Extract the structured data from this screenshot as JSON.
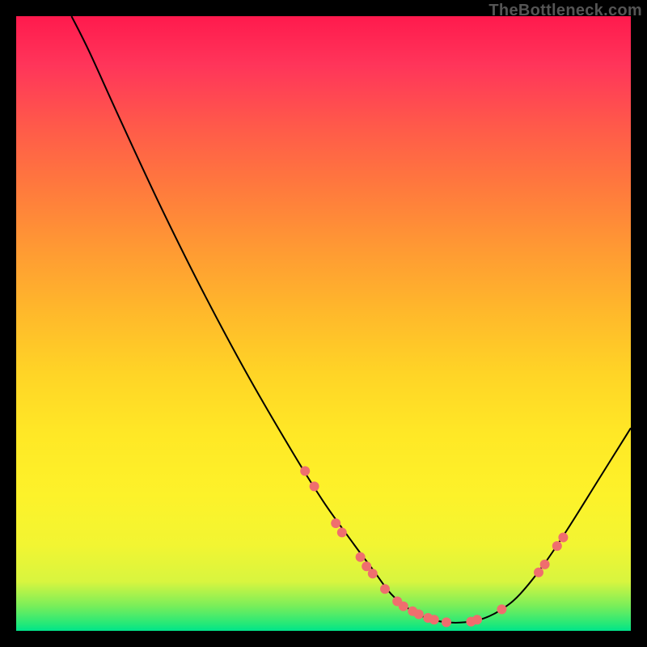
{
  "watermark": "TheBottleneck.com",
  "chart_data": {
    "type": "line",
    "title": "",
    "xlabel": "",
    "ylabel": "",
    "xlim": [
      0,
      100
    ],
    "ylim": [
      0,
      100
    ],
    "curve": [
      {
        "x": 9,
        "y": 100
      },
      {
        "x": 12,
        "y": 94
      },
      {
        "x": 17,
        "y": 83
      },
      {
        "x": 24,
        "y": 68
      },
      {
        "x": 31,
        "y": 54
      },
      {
        "x": 38,
        "y": 41
      },
      {
        "x": 45,
        "y": 29
      },
      {
        "x": 50,
        "y": 21
      },
      {
        "x": 55,
        "y": 14
      },
      {
        "x": 58,
        "y": 10
      },
      {
        "x": 61,
        "y": 6
      },
      {
        "x": 64,
        "y": 3.5
      },
      {
        "x": 67,
        "y": 2.0
      },
      {
        "x": 70,
        "y": 1.4
      },
      {
        "x": 73,
        "y": 1.4
      },
      {
        "x": 76,
        "y": 2.0
      },
      {
        "x": 79,
        "y": 3.5
      },
      {
        "x": 82,
        "y": 6
      },
      {
        "x": 86,
        "y": 11
      },
      {
        "x": 90,
        "y": 17
      },
      {
        "x": 95,
        "y": 25
      },
      {
        "x": 100,
        "y": 33
      }
    ],
    "markers": [
      {
        "x": 47,
        "y": 26
      },
      {
        "x": 48.5,
        "y": 23.5
      },
      {
        "x": 52,
        "y": 17.5
      },
      {
        "x": 53,
        "y": 16
      },
      {
        "x": 56,
        "y": 12
      },
      {
        "x": 57,
        "y": 10.5
      },
      {
        "x": 58,
        "y": 9.3
      },
      {
        "x": 60,
        "y": 6.8
      },
      {
        "x": 62,
        "y": 4.8
      },
      {
        "x": 63,
        "y": 4.0
      },
      {
        "x": 64.5,
        "y": 3.2
      },
      {
        "x": 65.5,
        "y": 2.7
      },
      {
        "x": 67,
        "y": 2.1
      },
      {
        "x": 68,
        "y": 1.8
      },
      {
        "x": 70,
        "y": 1.4
      },
      {
        "x": 74,
        "y": 1.5
      },
      {
        "x": 75,
        "y": 1.8
      },
      {
        "x": 79,
        "y": 3.5
      },
      {
        "x": 85,
        "y": 9.5
      },
      {
        "x": 86,
        "y": 10.8
      },
      {
        "x": 88,
        "y": 13.8
      },
      {
        "x": 89,
        "y": 15.2
      }
    ],
    "marker_color": "#ef6e6e",
    "marker_radius_px": 6
  }
}
